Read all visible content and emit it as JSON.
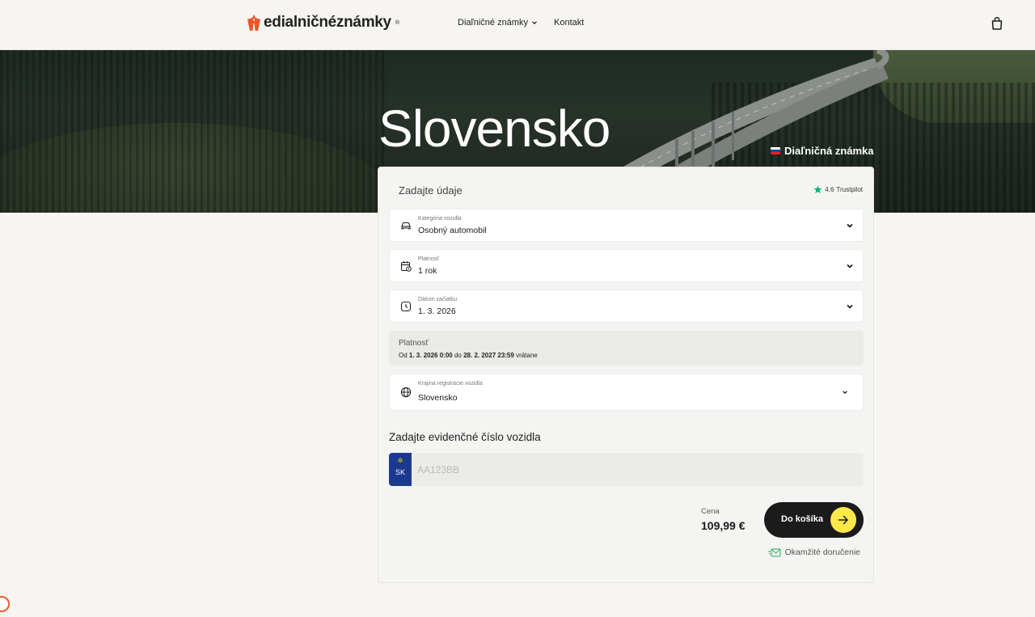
{
  "header": {
    "logo_text": "edialničnéznámky",
    "logo_reg": "®",
    "nav": {
      "dropdown_label": "Diaľničné známky",
      "contact_label": "Kontakt"
    },
    "cart_icon": "shopping-bag-icon"
  },
  "hero": {
    "title": "Slovensko",
    "tag_label": "Diaľničná známka"
  },
  "form": {
    "title": "Zadajte údaje",
    "trustpilot": {
      "rating": "4.6",
      "label": "Trustpilot"
    },
    "vehicle_category": {
      "label": "Kategória vozidla",
      "value": "Osobný automobil",
      "icon": "car-icon"
    },
    "validity_period": {
      "label": "Platnosť",
      "value": "1 rok",
      "icon": "calendar-icon"
    },
    "start_date": {
      "label": "Dátum začiatku",
      "value": "1. 3. 2026",
      "icon": "clock-icon"
    },
    "validity_summary": {
      "label": "Platnosť",
      "from_word": "Od",
      "from": "1. 3. 2026 0:00",
      "to_word": "do",
      "to": "28. 2. 2027 23:59",
      "suffix": "vrátane"
    },
    "registration_country": {
      "label": "Krajina registrácie vozidla",
      "value": "Slovensko",
      "icon": "globe-icon"
    },
    "plate": {
      "title": "Zadajte evidenčné číslo vozidla",
      "country_code": "SK",
      "placeholder": "AA123BB",
      "value": ""
    },
    "price": {
      "label": "Cena",
      "value": "109,99 €"
    },
    "add_to_cart_label": "Do košíka",
    "instant_delivery_label": "Okamžité doručenie"
  },
  "colors": {
    "accent_yellow": "#ffe94a",
    "logo_orange": "#f0552a",
    "eu_blue": "#1a3a8f",
    "trustpilot_green": "#00b67a"
  }
}
